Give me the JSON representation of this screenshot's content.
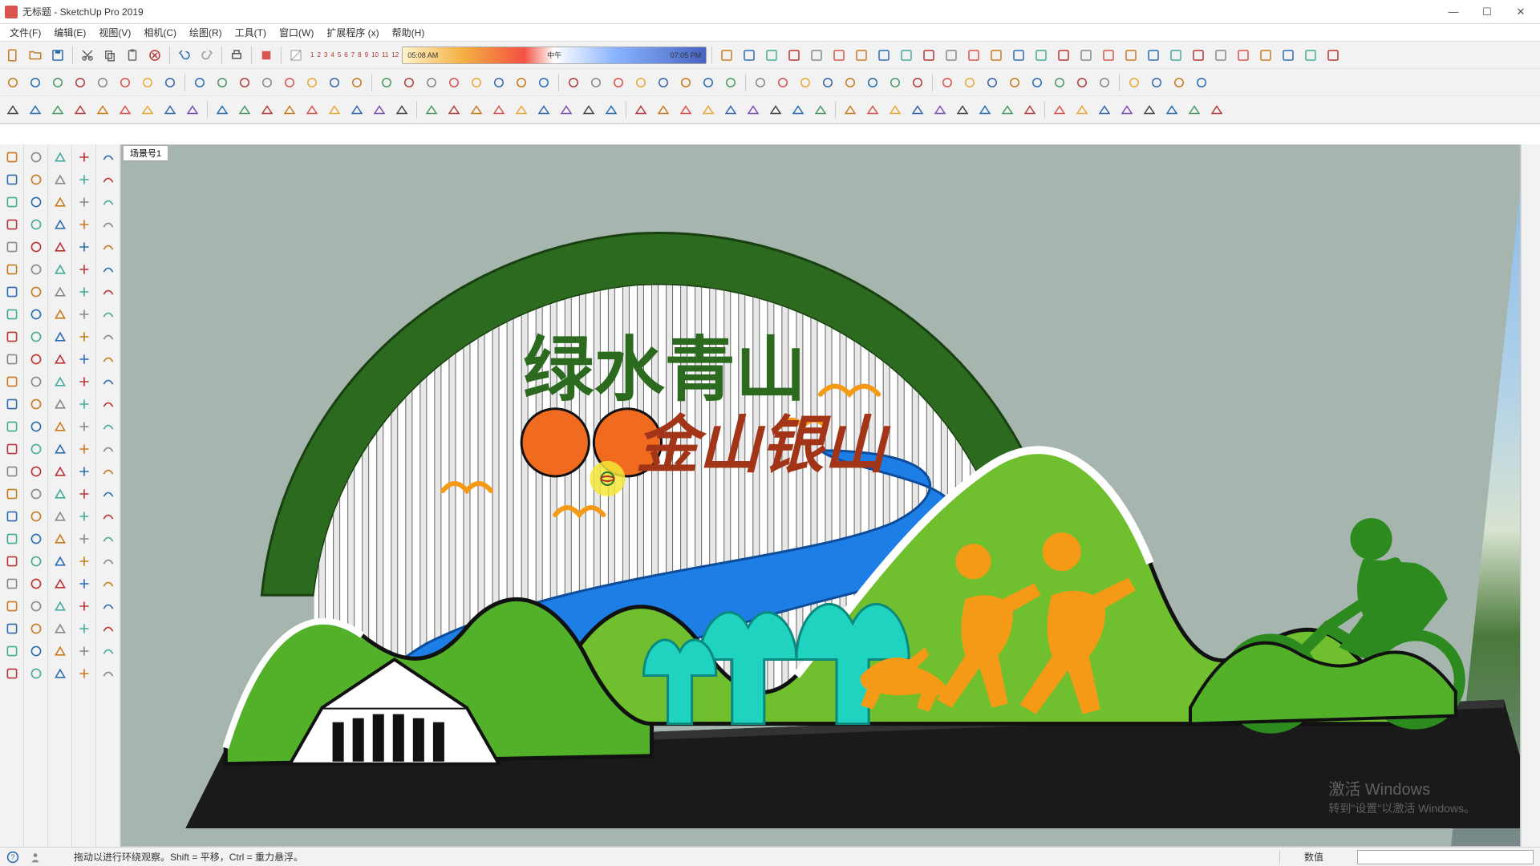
{
  "window": {
    "title": "无标题 - SketchUp Pro 2019",
    "buttons": {
      "min": "—",
      "max": "☐",
      "close": "✕"
    }
  },
  "menu": {
    "items": [
      "文件(F)",
      "编辑(E)",
      "视图(V)",
      "相机(C)",
      "绘图(R)",
      "工具(T)",
      "窗口(W)",
      "扩展程序 (x)",
      "帮助(H)"
    ]
  },
  "shadow": {
    "numbers": [
      "1",
      "2",
      "3",
      "4",
      "5",
      "6",
      "7",
      "8",
      "9",
      "10",
      "11",
      "12"
    ],
    "time_left": "05:08 AM",
    "time_mid": "中午",
    "time_right": "07:05 PM"
  },
  "scene_tab": "场景号1",
  "status": {
    "hint": "拖动以进行环绕观察。Shift = 平移，Ctrl = 重力悬浮。",
    "vcb_label": "数值"
  },
  "watermark": {
    "line1": "激活 Windows",
    "line2": "转到\"设置\"以激活 Windows。"
  },
  "toolbar_icons_row1": [
    "new",
    "open",
    "save",
    "sep",
    "cut",
    "copy",
    "paste",
    "delete",
    "sep",
    "undo",
    "redo",
    "sep",
    "print",
    "sep",
    "model-info",
    "sep",
    "shadow-toggle"
  ],
  "toolbar_icons_row2": [
    "select",
    "lasso",
    "sep",
    "iso",
    "top",
    "front",
    "right",
    "back",
    "sep",
    "group-edit",
    "sep",
    "open-folder",
    "new-folder",
    "png",
    "jpg",
    "svg",
    "pen",
    "sep",
    "clock",
    "shield",
    "pm",
    "page",
    "page2",
    "expand",
    "aplus"
  ],
  "toolbar_icons_row3": [
    "styles1",
    "styles2",
    "sep",
    "paint",
    "sep",
    "push-pull",
    "sep",
    "offset",
    "followme",
    "sep",
    "move",
    "rotate",
    "scale",
    "sep",
    "tape",
    "protractor",
    "text",
    "axes",
    "dims",
    "sep",
    "section",
    "sep",
    "walk",
    "look",
    "sep",
    "position-camera",
    "sep",
    "sandbox1",
    "sandbox2"
  ],
  "colors": {
    "dark_green": "#2c6a1f",
    "light_green": "#52b029",
    "grass_green": "#6fbf2e",
    "teal": "#1fd3c0",
    "blue_river": "#1d7fe6",
    "orange": "#f59a16",
    "brown_red": "#a23418",
    "black": "#111",
    "base": "#1a1a1a"
  },
  "model_text": {
    "top_line": "绿水青山",
    "bottom_line": "金山银山"
  }
}
